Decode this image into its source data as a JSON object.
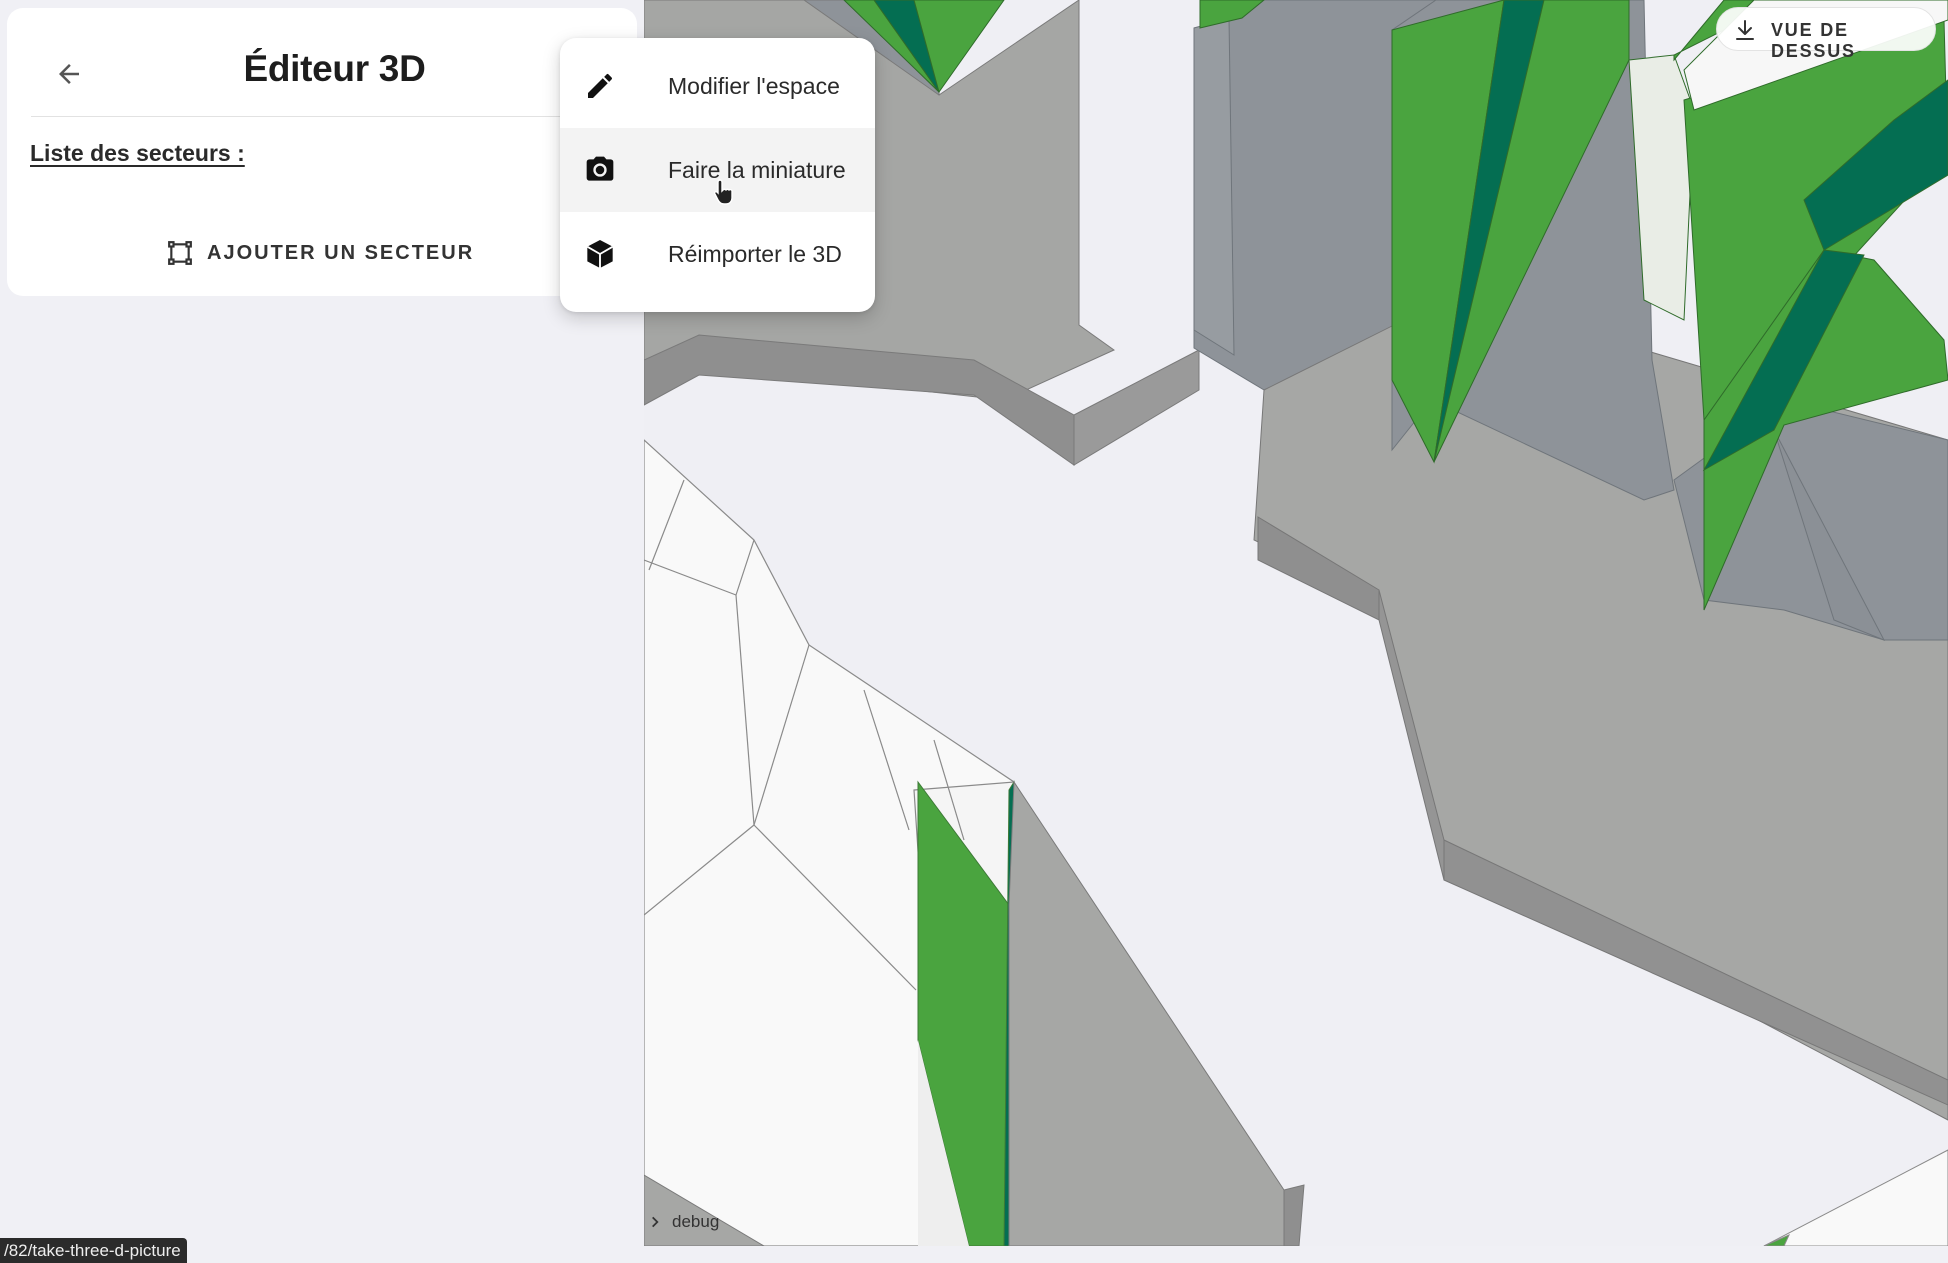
{
  "panel": {
    "title": "Éditeur 3D",
    "sectors_label": "Liste des secteurs :",
    "add_sector_label": "AJOUTER UN SECTEUR"
  },
  "menu": {
    "items": [
      {
        "label": "Modifier l'espace",
        "icon": "pencil-icon"
      },
      {
        "label": "Faire la miniature",
        "icon": "camera-icon"
      },
      {
        "label": "Réimporter le 3D",
        "icon": "cube-icon"
      }
    ],
    "hovered_index": 1
  },
  "viewport": {
    "top_view_label": "VUE DE DESSUS",
    "debug_label": "debug"
  },
  "status_bar": {
    "url": "/82/take-three-d-picture"
  },
  "colors": {
    "green": "#4aa43f",
    "dark_green": "#046e52",
    "gray_wall": "#8e9399",
    "floor": "#a5a6a4",
    "background": "#efeff4"
  }
}
